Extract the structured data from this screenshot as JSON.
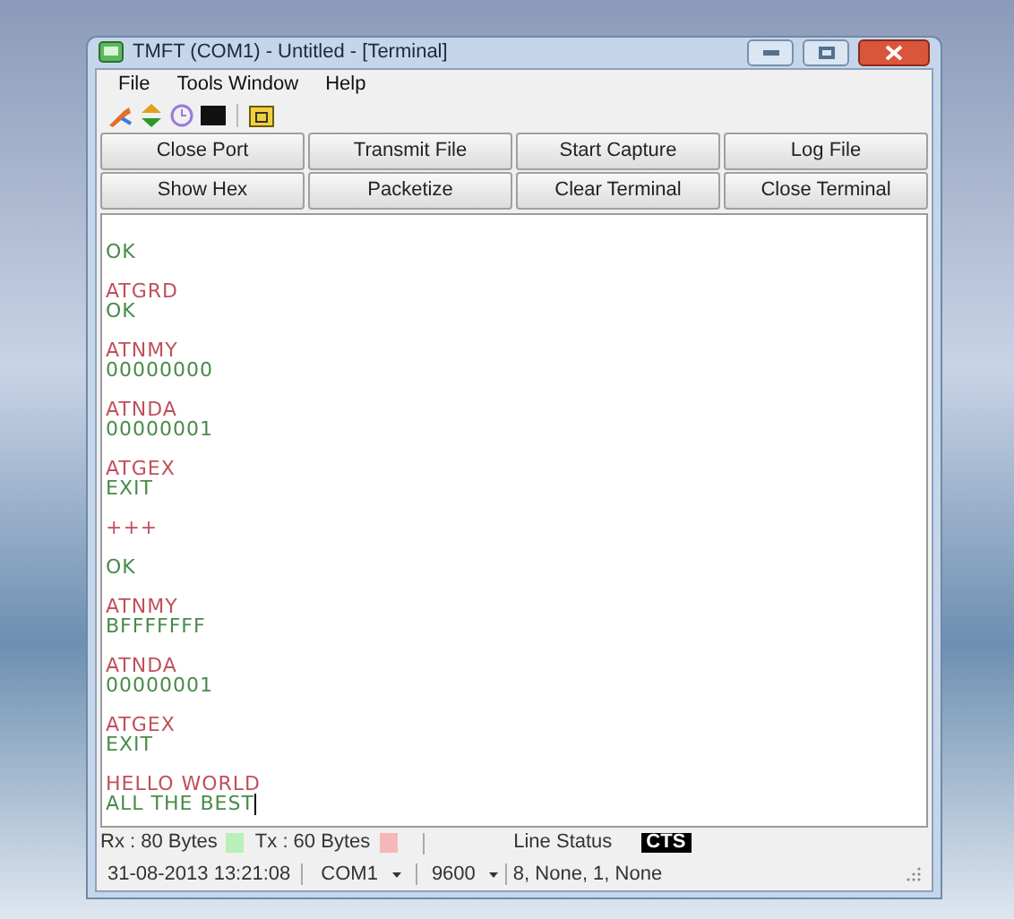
{
  "window": {
    "title": "TMFT (COM1) - Untitled - [Terminal]"
  },
  "menu": [
    "File",
    "Tools Window",
    "Help"
  ],
  "buttons": [
    [
      "Close Port",
      "Transmit File",
      "Start Capture",
      "Log File"
    ],
    [
      "Show Hex",
      "Packetize",
      "Clear Terminal",
      "Close Terminal"
    ]
  ],
  "terminal": [
    [
      {
        "kind": "received",
        "text": "OK"
      }
    ],
    [
      {
        "kind": "sent",
        "text": "ATGRD"
      },
      {
        "kind": "received",
        "text": "OK"
      }
    ],
    [
      {
        "kind": "sent",
        "text": "ATNMY"
      },
      {
        "kind": "received",
        "text": "00000000"
      }
    ],
    [
      {
        "kind": "sent",
        "text": "ATNDA"
      },
      {
        "kind": "received",
        "text": "00000001"
      }
    ],
    [
      {
        "kind": "sent",
        "text": "ATGEX"
      },
      {
        "kind": "received",
        "text": "EXIT"
      }
    ],
    [
      {
        "kind": "sent",
        "text": "+++"
      }
    ],
    [
      {
        "kind": "received",
        "text": "OK"
      }
    ],
    [
      {
        "kind": "sent",
        "text": "ATNMY"
      },
      {
        "kind": "received",
        "text": "BFFFFFFF"
      }
    ],
    [
      {
        "kind": "sent",
        "text": "ATNDA"
      },
      {
        "kind": "received",
        "text": "00000001"
      }
    ],
    [
      {
        "kind": "sent",
        "text": "ATGEX"
      },
      {
        "kind": "received",
        "text": "EXIT"
      }
    ],
    [
      {
        "kind": "sent",
        "text": "HELLO WORLD"
      },
      {
        "kind": "received",
        "text": "ALL THE BEST"
      }
    ]
  ],
  "status_bar": {
    "counters": [
      {
        "text": "Rx : 80 Bytes",
        "color": "#b8f0b8"
      },
      {
        "text": "Tx : 60 Bytes",
        "color": "#f5b8b8"
      }
    ],
    "line_status_label": "Line Status",
    "line_status": "CTS",
    "datetime": "31-08-2013 13:21:08",
    "port": "COM1",
    "baud": "9600",
    "settings": "8, None, 1, None"
  }
}
